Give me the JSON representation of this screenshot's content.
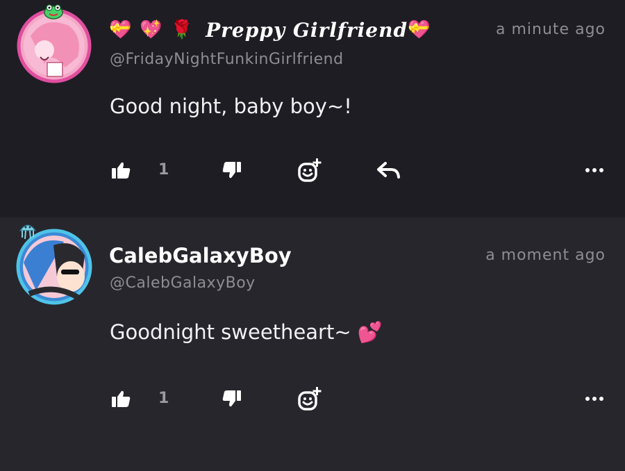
{
  "comments": [
    {
      "emojis": [
        "💝",
        "💖",
        "🌹"
      ],
      "display_name": "Preppy Girlfriend",
      "trailing_emoji": "💝",
      "handle": "@FridayNightFunkinGirlfriend",
      "time": "a minute ago",
      "text": "Good night, baby boy~!",
      "likes": "1",
      "avatar": "girlfriend-avatar",
      "badge": "frog-badge"
    },
    {
      "display_name": "CalebGalaxyBoy",
      "handle": "@CalebGalaxyBoy",
      "time": "a moment ago",
      "text": "Goodnight sweetheart~ 💕",
      "likes": "1",
      "avatar": "caleb-avatar",
      "badge": "jellyfish-badge"
    }
  ],
  "icons": {
    "like": "thumbs-up-icon",
    "dislike": "thumbs-down-icon",
    "react": "add-reaction-icon",
    "reply": "reply-icon",
    "more": "more-icon"
  },
  "colors": {
    "background": "#1e1d23",
    "secondary_background": "#27262c",
    "muted_text": "#8e8d95",
    "avatar_ring_pink": "#e04e9f",
    "avatar_ring_blue": "#4fc3e8"
  }
}
